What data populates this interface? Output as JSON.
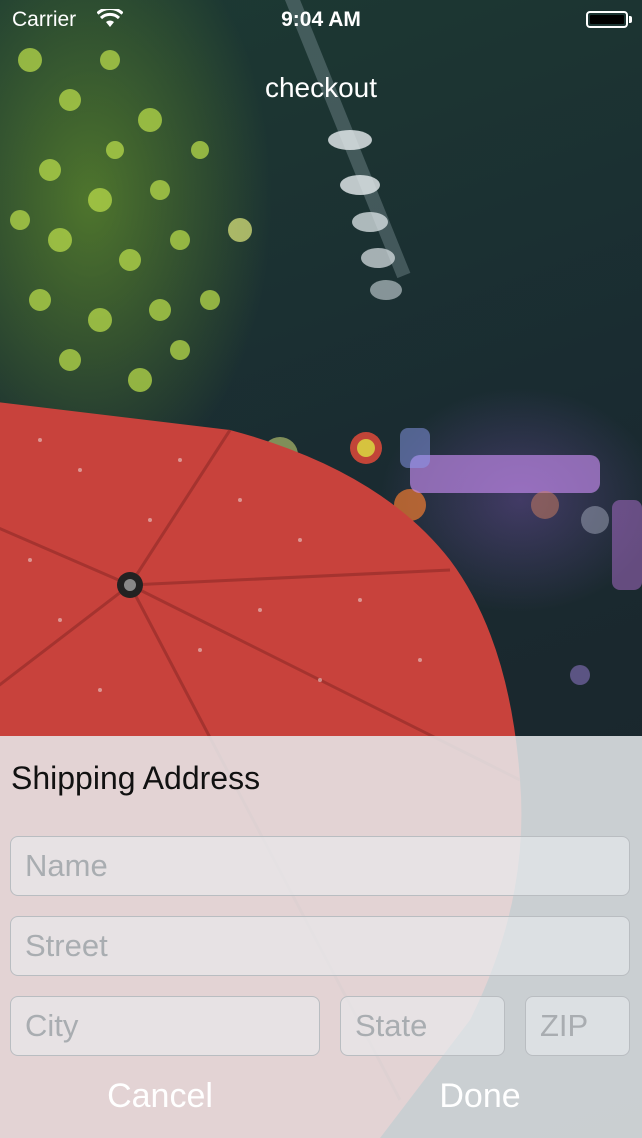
{
  "status_bar": {
    "carrier": "Carrier",
    "time": "9:04 AM"
  },
  "nav": {
    "title": "checkout"
  },
  "sheet": {
    "title": "Shipping Address",
    "fields": {
      "name": {
        "placeholder": "Name",
        "value": ""
      },
      "street": {
        "placeholder": "Street",
        "value": ""
      },
      "city": {
        "placeholder": "City",
        "value": ""
      },
      "state": {
        "placeholder": "State",
        "value": ""
      },
      "zip": {
        "placeholder": "ZIP",
        "value": ""
      }
    },
    "cancel_label": "Cancel",
    "done_label": "Done"
  },
  "background": {
    "description_icon": "umbrella-photo",
    "umbrella_color": "#c8423c"
  }
}
